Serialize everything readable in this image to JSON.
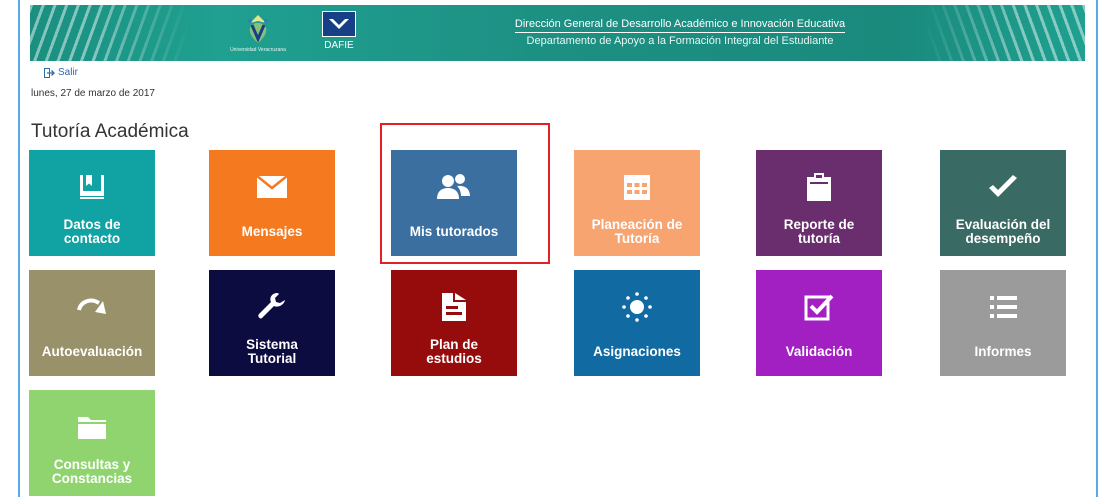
{
  "header": {
    "uv_logo_text": "Universidad Veracruzana",
    "dafie_label": "DAFIE",
    "title_line1": "Dirección General de Desarrollo Académico e Innovación Educativa",
    "title_line2": "Departamento de Apoyo a la Formación Integral del Estudiante"
  },
  "nav": {
    "salir_label": "Salir"
  },
  "date_text": "lunes, 27 de marzo de 2017",
  "page_title": "Tutoría Académica",
  "tiles": [
    {
      "label_1": "Datos de",
      "label_2": "contacto",
      "color": "#11a3a3",
      "icon": "book-icon"
    },
    {
      "label_1": "Mensajes",
      "label_2": "",
      "color": "#f57a1f",
      "icon": "envelope-icon"
    },
    {
      "label_1": "Mis tutorados",
      "label_2": "",
      "color": "#3a6fa0",
      "icon": "users-icon"
    },
    {
      "label_1": "Planeación de",
      "label_2": "Tutoría",
      "color": "#f7a470",
      "icon": "calendar-icon"
    },
    {
      "label_1": "Reporte de",
      "label_2": "tutoría",
      "color": "#6a2e6e",
      "icon": "clipboard-icon"
    },
    {
      "label_1": "Evaluación del",
      "label_2": "desempeño",
      "color": "#3a6a64",
      "icon": "check-icon"
    },
    {
      "label_1": "Autoevaluación",
      "label_2": "",
      "color": "#999169",
      "icon": "arrow-icon"
    },
    {
      "label_1": "Sistema",
      "label_2": "Tutorial",
      "color": "#0c0c40",
      "icon": "wrench-icon"
    },
    {
      "label_1": "Plan de",
      "label_2": "estudios",
      "color": "#960c0c",
      "icon": "document-icon"
    },
    {
      "label_1": "Asignaciones",
      "label_2": "",
      "color": "#126aa2",
      "icon": "sun-icon"
    },
    {
      "label_1": "Validación",
      "label_2": "",
      "color": "#a21fc2",
      "icon": "check-square-icon"
    },
    {
      "label_1": "Informes",
      "label_2": "",
      "color": "#9b9b9b",
      "icon": "list-icon"
    },
    {
      "label_1": "Consultas y",
      "label_2": "Constancias",
      "color": "#8fd46e",
      "icon": "folder-icon"
    }
  ]
}
